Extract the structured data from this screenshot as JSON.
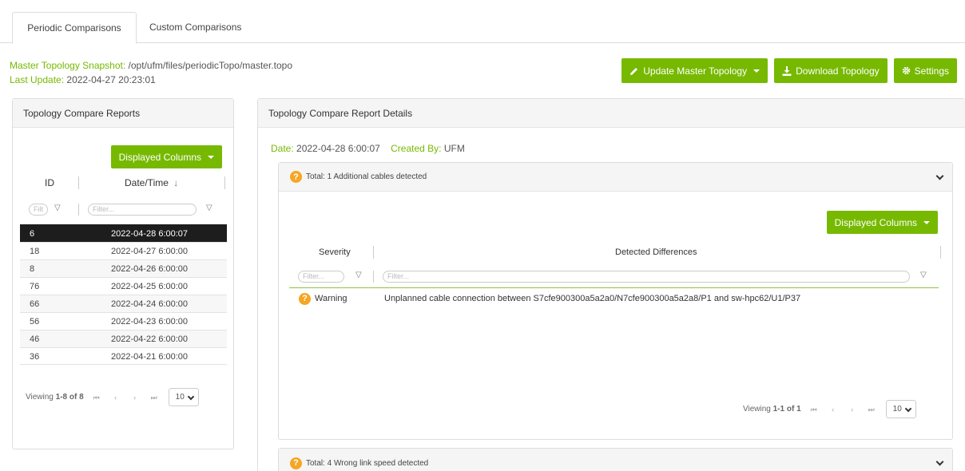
{
  "tabs": {
    "periodic": "Periodic Comparisons",
    "custom": "Custom Comparisons"
  },
  "master": {
    "snapshot_label": "Master Topology Snapshot:",
    "snapshot_value": "/opt/ufm/files/periodicTopo/master.topo",
    "update_label": "Last Update:",
    "update_value": "2022-04-27 20:23:01"
  },
  "actions": {
    "update_master": "Update Master Topology",
    "download": "Download Topology",
    "settings": "Settings"
  },
  "left_panel": {
    "title": "Topology Compare Reports",
    "displayed_columns": "Displayed Columns",
    "columns": [
      "ID",
      "Date/Time"
    ],
    "id_filter_placeholder": "Filt",
    "date_filter_placeholder": "Filter...",
    "rows": [
      {
        "id": "6",
        "date": "2022-04-28 6:00:07",
        "selected": true
      },
      {
        "id": "18",
        "date": "2022-04-27 6:00:00"
      },
      {
        "id": "8",
        "date": "2022-04-26 6:00:00"
      },
      {
        "id": "76",
        "date": "2022-04-25 6:00:00"
      },
      {
        "id": "66",
        "date": "2022-04-24 6:00:00"
      },
      {
        "id": "56",
        "date": "2022-04-23 6:00:00"
      },
      {
        "id": "46",
        "date": "2022-04-22 6:00:00"
      },
      {
        "id": "36",
        "date": "2022-04-21 6:00:00"
      }
    ],
    "pager": {
      "viewing_label": "Viewing",
      "viewing_range": "1-8 of 8",
      "page_size": "10"
    }
  },
  "right_panel": {
    "title": "Topology Compare Report Details",
    "date_label": "Date:",
    "date_value": "2022-04-28 6:00:07",
    "created_label": "Created By:",
    "created_value": "UFM",
    "sections": [
      {
        "header": "Total: 1 Additional cables detected",
        "displayed_columns": "Displayed Columns",
        "columns": [
          "Severity",
          "Detected Differences"
        ],
        "severity_filter_placeholder": "Filter...",
        "diff_filter_placeholder": "Filter...",
        "rows": [
          {
            "severity": "Warning",
            "difference": "Unplanned cable connection between S7cfe900300a5a2a0/N7cfe900300a5a2a8/P1 and sw-hpc62/U1/P37"
          }
        ],
        "pager": {
          "viewing_label": "Viewing",
          "viewing_range": "1-1 of 1",
          "page_size": "10"
        }
      },
      {
        "header": "Total: 4 Wrong link speed detected"
      }
    ]
  },
  "colors": {
    "accent": "#76b900",
    "selected_row": "#1d1d1d",
    "warning": "#f5a623"
  }
}
